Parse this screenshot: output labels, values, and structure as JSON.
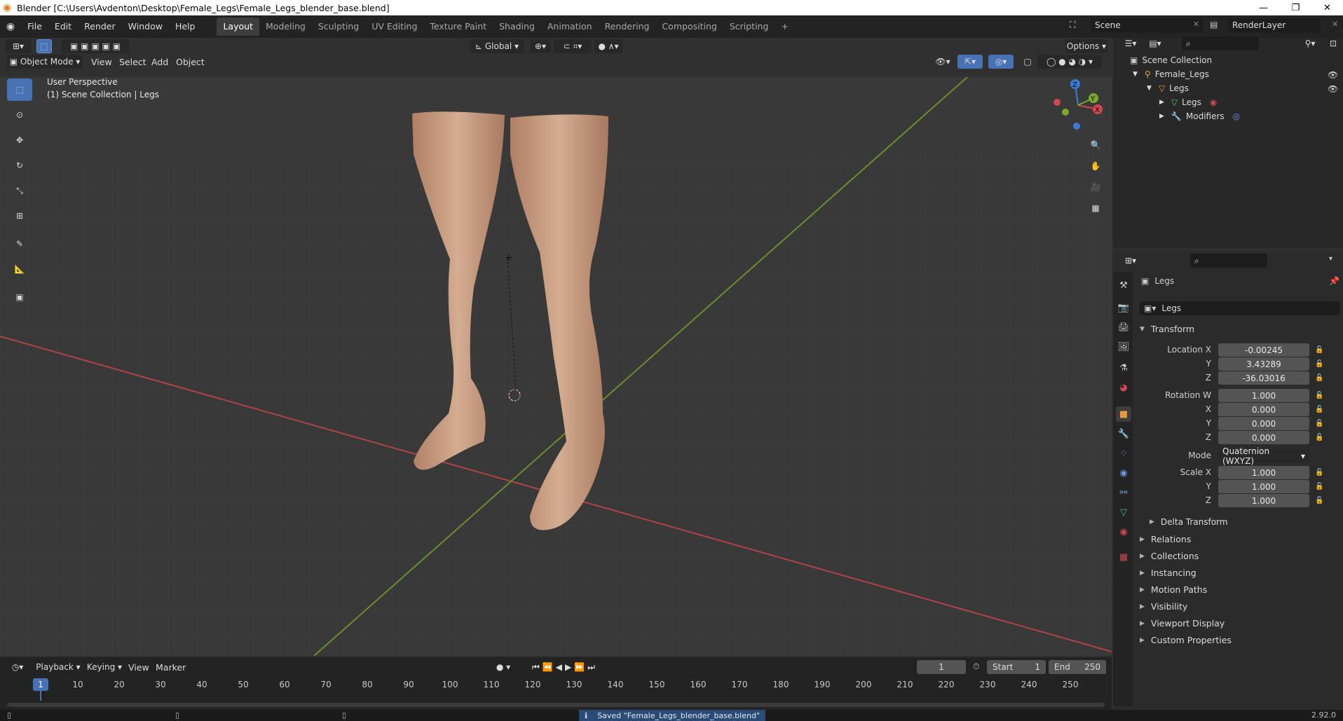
{
  "window": {
    "title": "Blender [C:\\Users\\Avdenton\\Desktop\\Female_Legs\\Female_Legs_blender_base.blend]"
  },
  "menu": [
    "File",
    "Edit",
    "Render",
    "Window",
    "Help"
  ],
  "workspaces": [
    "Layout",
    "Modeling",
    "Sculpting",
    "UV Editing",
    "Texture Paint",
    "Shading",
    "Animation",
    "Rendering",
    "Compositing",
    "Scripting"
  ],
  "scene": {
    "name": "Scene",
    "render_layer": "RenderLayer"
  },
  "viewport_header": {
    "mode": "Object Mode",
    "menus": [
      "View",
      "Select",
      "Add",
      "Object"
    ],
    "orientation": "Global",
    "options": "Options"
  },
  "viewport": {
    "perspective": "User Perspective",
    "collection_info": "(1) Scene Collection | Legs",
    "axis_x": "X",
    "axis_y": "Y",
    "axis_z": "Z"
  },
  "outliner": {
    "root": "Scene Collection",
    "items": [
      "Female_Legs",
      "Legs",
      "Legs",
      "Modifiers"
    ]
  },
  "properties": {
    "object_name": "Legs",
    "data_name": "Legs",
    "transform_title": "Transform",
    "location": {
      "label": "Location X",
      "x": "-0.00245",
      "y": "3.43289",
      "z": "-36.03016"
    },
    "rotation": {
      "label": "Rotation W",
      "w": "1.000",
      "x": "0.000",
      "y": "0.000",
      "z": "0.000"
    },
    "mode": {
      "label": "Mode",
      "value": "Quaternion (WXYZ)"
    },
    "scale": {
      "label": "Scale X",
      "x": "1.000",
      "y": "1.000",
      "z": "1.000"
    },
    "axis_labels": {
      "x": "X",
      "y": "Y",
      "z": "Z"
    },
    "delta": "Delta Transform",
    "sections": [
      "Relations",
      "Collections",
      "Instancing",
      "Motion Paths",
      "Visibility",
      "Viewport Display",
      "Custom Properties"
    ]
  },
  "timeline": {
    "menus": [
      "Playback",
      "Keying",
      "View",
      "Marker"
    ],
    "current_frame": "1",
    "start_label": "Start",
    "start": "1",
    "end_label": "End",
    "end": "250",
    "ticks": [
      "1",
      "10",
      "20",
      "30",
      "40",
      "50",
      "60",
      "70",
      "80",
      "90",
      "100",
      "110",
      "120",
      "130",
      "140",
      "150",
      "160",
      "170",
      "180",
      "190",
      "200",
      "210",
      "220",
      "230",
      "240",
      "250"
    ]
  },
  "status": {
    "message": "Saved \"Female_Legs_blender_base.blend\"",
    "version": "2.92.0"
  },
  "colors": {
    "accent": "#4772b3",
    "x_axis": "#d0484f",
    "y_axis": "#7ba82d",
    "z_axis": "#3b7bd8",
    "skin": "#c9a084"
  }
}
